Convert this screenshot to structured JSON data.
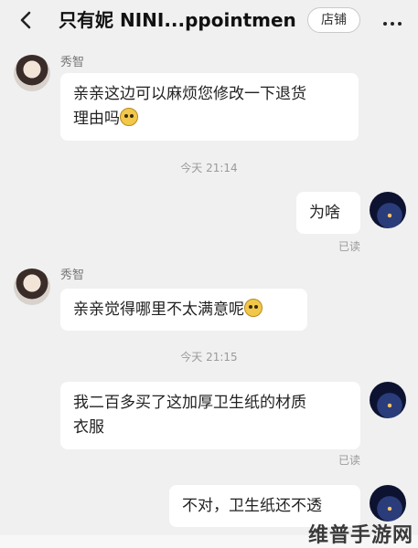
{
  "header": {
    "title": "只有妮 NINI...ppointment",
    "shop_label": "店铺",
    "back_icon": "chevron-left-icon",
    "more_icon": "more-dots-icon"
  },
  "messages": [
    {
      "sender": "秀智",
      "text": "亲亲这边可以麻烦您修改一下退货\n理由吗",
      "emoji": "smiling-cat-emoji"
    },
    {
      "timestamp": "今天 21:14"
    },
    {
      "text": "为啥",
      "status": "已读"
    },
    {
      "sender": "秀智",
      "text": "亲亲觉得哪里不太满意呢",
      "emoji": "smiling-cat-emoji"
    },
    {
      "timestamp": "今天 21:15"
    },
    {
      "text": "我二百多买了这加厚卫生纸的材质\n衣服",
      "status": "已读"
    },
    {
      "text": "不对，卫生纸还不透"
    }
  ],
  "watermark": "维普手游网"
}
